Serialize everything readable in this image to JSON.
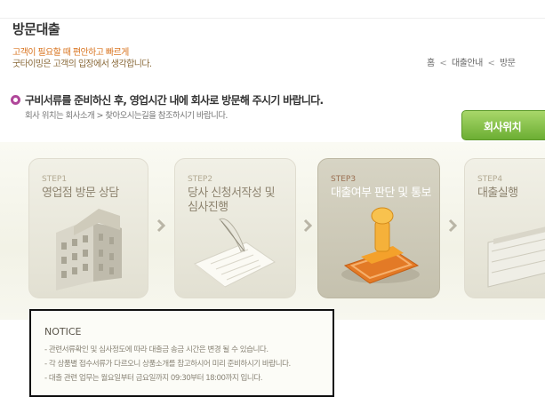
{
  "header": {
    "title": "방문대출",
    "slogan_line1": "고객이 필요할 때 편안하고 빠르게",
    "slogan_line2": "굿타이밍은 고객의 입장에서 생각합니다."
  },
  "breadcrumb": {
    "items": [
      "홈",
      "대출안내",
      "방문"
    ],
    "separator": "<"
  },
  "info": {
    "main": "구비서류를 준비하신 후, 영업시간 내에 회사로 방문해 주시기 바랍니다.",
    "sub": "회사 위치는 회사소개 > 찾아오시는길을 참조하시기 바랍니다.",
    "location_button": "회사위치"
  },
  "steps": [
    {
      "num": "STEP1",
      "title": "영업점 방문 상담",
      "icon": "building-icon"
    },
    {
      "num": "STEP2",
      "title_line1": "당사 신청서작성 및",
      "title_line2": "심사진행",
      "icon": "quill-document-icon"
    },
    {
      "num": "STEP3",
      "title": "대출여부 판단 및 통보",
      "icon": "stamp-icon",
      "active": true
    },
    {
      "num": "STEP4",
      "title": "대출실행",
      "icon": "cash-icon"
    }
  ],
  "notice": {
    "title": "NOTICE",
    "lines": [
      "- 관련서류확인 및 심사정도에 따라 대출금 송금 시간은 변경 될 수 있습니다.",
      "- 각 상품별 접수서류가 다르오니 상품소개를 참고하시어 미리 준비하시기 바랍니다.",
      "- 대출 관련 업무는 월요일부터 금요일까지 09:30부터 18:00까지 입니다."
    ]
  },
  "colors": {
    "accent_orange": "#d9741f",
    "bullet_purple": "#b0479a",
    "button_green": "#6cae33"
  }
}
